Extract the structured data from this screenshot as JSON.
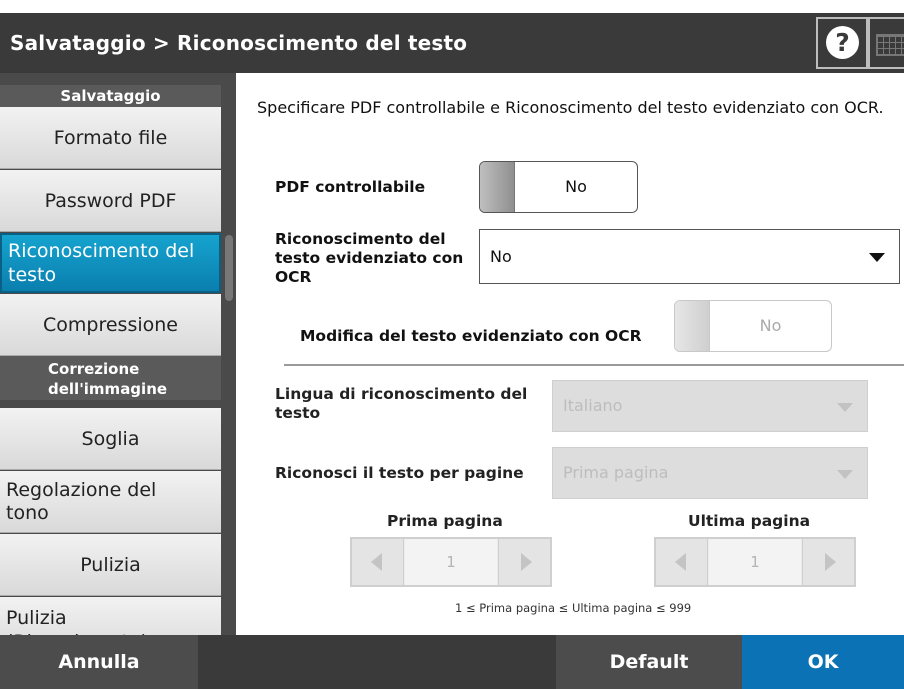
{
  "header": {
    "title": "Salvataggio > Riconoscimento del testo",
    "help_icon": "question-circle-icon",
    "keyboard_icon": "keyboard-icon"
  },
  "sidebar": {
    "section1": "Salvataggio",
    "items1": [
      "Formato file",
      "Password PDF",
      "Riconoscimento del testo",
      "Compressione"
    ],
    "section2": "Correzione dell'immagine",
    "items2": [
      "Soglia",
      "Regolazione del tono",
      "Pulizia",
      "Pulizia (Riempimento)"
    ],
    "active_item": "Riconoscimento del testo"
  },
  "main": {
    "description": "Specificare PDF controllabile e Riconoscimento del testo evidenziato con OCR.",
    "searchable_pdf": {
      "label": "PDF controllabile",
      "value": "No"
    },
    "ocr_highlight": {
      "label": "Riconoscimento del testo evidenziato con OCR",
      "value": "No"
    },
    "ocr_edit": {
      "label": "Modifica del testo evidenziato con OCR",
      "value": "No"
    },
    "language": {
      "label": "Lingua di riconoscimento del testo",
      "value": "Italiano"
    },
    "pages_mode": {
      "label": "Riconosci il testo per pagine",
      "value": "Prima pagina"
    },
    "first_page": {
      "label": "Prima pagina",
      "value": "1"
    },
    "last_page": {
      "label": "Ultima pagina",
      "value": "1"
    },
    "range_note": "1 ≤ Prima pagina ≤ Ultima pagina ≤ 999"
  },
  "footer": {
    "cancel": "Annulla",
    "default": "Default",
    "ok": "OK"
  },
  "colors": {
    "titlebar": "#3a3a3a",
    "sidebar_active": "#0a8fc2",
    "ok_button": "#0b73b5"
  }
}
